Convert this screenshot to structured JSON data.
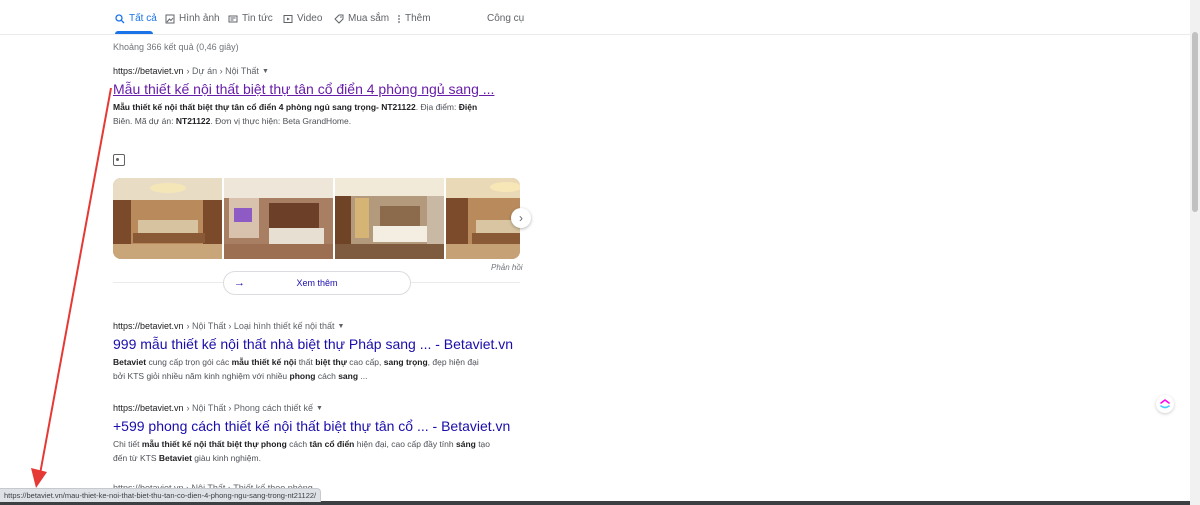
{
  "tabs": [
    {
      "label": "Tất cả",
      "icon": "search-icon",
      "active": true
    },
    {
      "label": "Hình ảnh",
      "icon": "image-icon"
    },
    {
      "label": "Tin tức",
      "icon": "news-icon"
    },
    {
      "label": "Video",
      "icon": "video-icon"
    },
    {
      "label": "Mua sắm",
      "icon": "tag-icon"
    },
    {
      "label": "Thêm",
      "icon": "more-vert-icon"
    }
  ],
  "tools_label": "Công cụ",
  "stats": "Khoảng 366 kết quả (0,46 giây)",
  "results": [
    {
      "site": "https://betaviet.vn",
      "path": "› Dự án › Nội Thất",
      "title": "Mẫu thiết kế nội thất biệt thự tân cổ điển 4 phòng ngủ sang ...",
      "snippet_html": "<b>Mẫu thiết kế nội thất biệt thự tân cổ điển 4 phòng ngủ sang trọng- NT21122</b>. Địa điểm: <b>Điện</b> Biên. Mã dự án: <b>NT21122</b>. Đơn vị thực hiện: Beta GrandHome."
    },
    {
      "site": "https://betaviet.vn",
      "path": "› Nội Thất › Loại hình thiết kế nội thất",
      "title": "999 mẫu thiết kế nội thất nhà biệt thự Pháp sang ... - Betaviet.vn",
      "snippet_html": "<b>Betaviet</b> cung cấp trọn gói các <b>mẫu thiết kế nội</b> thất <b>biệt thự</b> cao cấp, <b>sang trọng</b>, đẹp hiện đại bởi KTS giỏi nhiều năm kinh nghiệm với nhiều <b>phong</b> cách <b>sang</b> ..."
    },
    {
      "site": "https://betaviet.vn",
      "path": "› Nội Thất › Phong cách thiết kế",
      "title": "+599 phong cách thiết kế nội thất biệt thự tân cổ ... - Betaviet.vn",
      "snippet_html": "Chi tiết <b>mẫu thiết kế nội thất biệt thự phong</b> cách <b>tân cổ điển</b> hiện đại, cao cấp đầy tính <b>sáng</b> tạo đến từ KTS <b>Betaviet</b> giàu kinh nghiệm."
    }
  ],
  "cut_result": {
    "site": "https://betaviet.vn",
    "path": "› Nội Thất › Thiết kế theo phòng"
  },
  "view_more_label": "Xem thêm",
  "feedback_label": "Phản hồi",
  "status_url": "https://betaviet.vn/mau-thiet-ke-noi-that-biet-thu-tan-co-dien-4-phong-ngu-sang-trong-nt21122/",
  "colors": {
    "link": "#1a0dab",
    "visited": "#681da8",
    "accent": "#1a73e8",
    "annotation_arrow": "#e53935"
  }
}
